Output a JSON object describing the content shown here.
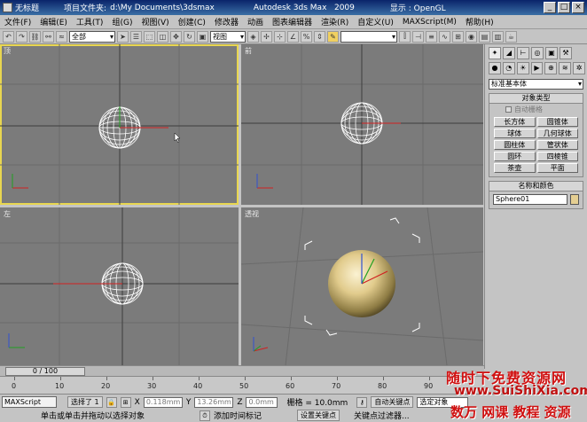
{
  "window": {
    "doc_name": "无标题",
    "project_label": "项目文件夹:",
    "project_path": "d:\\My Documents\\3dsmax",
    "app_title": "Autodesk 3ds Max   2009",
    "display_mode": "显示 : OpenGL",
    "minimize": "_",
    "maximize": "□",
    "close": "×"
  },
  "menu": [
    "文件(F)",
    "编辑(E)",
    "工具(T)",
    "组(G)",
    "视图(V)",
    "创建(C)",
    "修改器",
    "动画",
    "图表编辑器",
    "渲染(R)",
    "自定义(U)",
    "MAXScript(M)",
    "帮助(H)"
  ],
  "toolbar": {
    "selection_filter": "全部",
    "ref_coord": "视图"
  },
  "viewports": {
    "top": "顶",
    "front": "前",
    "left": "左",
    "perspective": "透视"
  },
  "command_panel": {
    "category": "标准基本体",
    "object_type_header": "对象类型",
    "autogrid": "自动栅格",
    "buttons": [
      "长方体",
      "圆锥体",
      "球体",
      "几何球体",
      "圆柱体",
      "管状体",
      "圆环",
      "四棱锥",
      "茶壶",
      "平面"
    ],
    "name_color_header": "名称和颜色",
    "object_name": "Sphere01"
  },
  "timeline": {
    "frame_indicator": "0 / 100",
    "ticks": [
      "0",
      "10",
      "20",
      "30",
      "40",
      "50",
      "60",
      "70",
      "80",
      "90"
    ]
  },
  "status": {
    "maxscript": "MAXScript",
    "selected": "选择了 1",
    "x_label": "X",
    "x_value": "0.118mm",
    "y_label": "Y",
    "y_value": "13.26mm",
    "z_label": "Z",
    "z_value": "0.0mm",
    "grid": "栅格 = 10.0mm",
    "auto_key": "自动关键点",
    "selected_object": "选定对象",
    "prompt": "单击或单击并拖动以选择对象",
    "add_time_tag": "添加时间标记",
    "set_key": "设置关键点",
    "key_filters": "关键点过滤器..."
  },
  "watermark": {
    "line1": "随时下免费资源网",
    "line2": "www.SuiShiXia.com",
    "line3": "数万 网课 教程 资源"
  },
  "colors": {
    "viewport_bg": "#7b7b7b",
    "active_border": "#e8d650",
    "sphere_color": "#e5cf92",
    "watermark": "#d01010"
  }
}
